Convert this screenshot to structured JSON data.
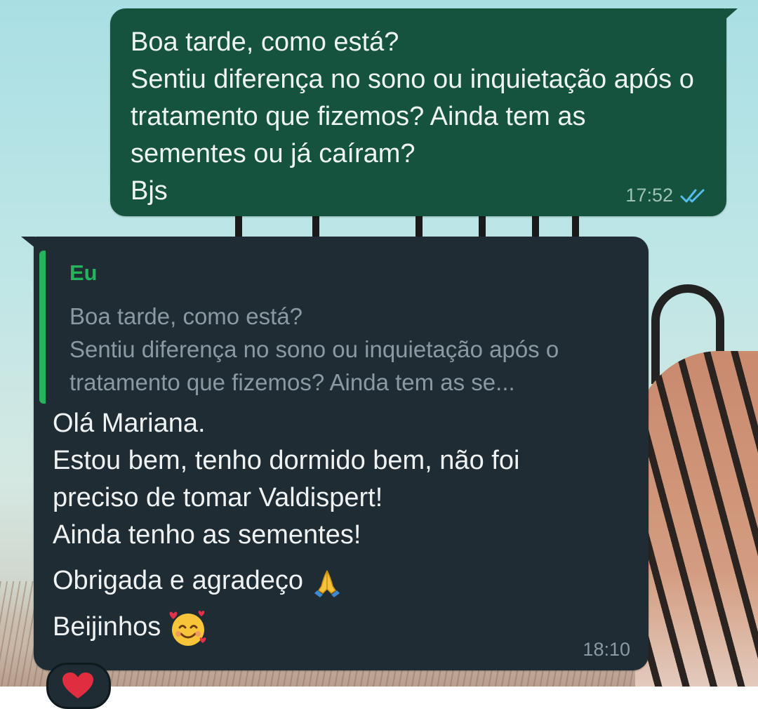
{
  "outgoing_message": {
    "text": "Boa tarde, como está?\nSentiu diferença no sono ou inquietação após o tratamento que fizemos?  Ainda tem as sementes ou já caíram?\nBjs",
    "time": "17:52",
    "status_icon": "double-check-read-icon"
  },
  "incoming_message": {
    "quoted": {
      "author": "Eu",
      "text": "Boa tarde, como está?\nSentiu diferença no sono ou inquietação após o tratamento que fizemos?  Ainda tem as se..."
    },
    "lines": {
      "l1": "Olá Mariana.",
      "l2": "Estou bem, tenho dormido bem, não foi",
      "l3": "preciso de tomar Valdispert!",
      "l4": "Ainda tenho as sementes!",
      "l5": "Obrigada e agradeço",
      "l6": "Beijinhos"
    },
    "emojis": {
      "after_l5": "praying-hands-emoji",
      "after_l6": "smiling-face-with-hearts-emoji"
    },
    "time": "18:10",
    "reaction": "red-heart-icon"
  },
  "colors": {
    "outgoing_bubble": "#15533f",
    "incoming_bubble": "#1f2c33",
    "quote_accent": "#25b35b",
    "read_ticks": "#53bdeb"
  }
}
